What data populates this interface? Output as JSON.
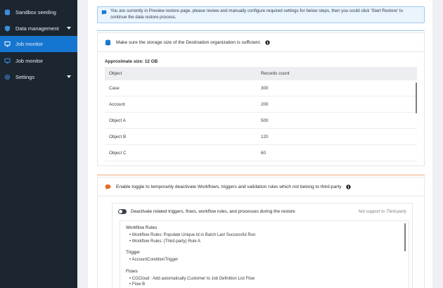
{
  "sidebar": {
    "items": [
      {
        "label": "Sandbox seeding",
        "icon": "database-icon"
      },
      {
        "label": "Data management",
        "icon": "shield-icon",
        "has_chevron": true
      },
      {
        "label": "Job monitor",
        "icon": "monitor-icon",
        "active": true
      },
      {
        "label": "Job monitor",
        "icon": "monitor-icon"
      },
      {
        "label": "Settings",
        "icon": "gear-icon",
        "has_chevron": true
      }
    ]
  },
  "info_banner": {
    "text": "You are currently in Preview restore page, please review and manually configure required settings for below steps, then you could click 'Start Restore' to continue the data restore process."
  },
  "storage_panel": {
    "title": "Make sure the storage size of the Destination organization is sufficient.",
    "size_label": "Approximate size: 12 GB",
    "columns": [
      "Object",
      "Records count"
    ],
    "rows": [
      {
        "object": "Case",
        "count": "300"
      },
      {
        "object": "Account",
        "count": "200"
      },
      {
        "object": "Object A",
        "count": "500"
      },
      {
        "object": "Object B",
        "count": "120"
      },
      {
        "object": "Object C",
        "count": "60"
      }
    ]
  },
  "toggle_panel": {
    "title": "Enable toggle to temporarily deactivate Workflows, triggers and validation rules which not belong to third-party",
    "toggle_label": "Deactivate related triggers, flows, workflow rules, and processes during the restore",
    "not_support_label": "Not support to Third-party",
    "groups": [
      {
        "title": "Workflow Rules",
        "items": [
          "Workflow Rules: Populate Unique Id in Batch Last Successful Run",
          "Workflow Rules: (Third-party) Rule A"
        ]
      },
      {
        "title": "Trigger",
        "items": [
          "AccountConditionTrigger"
        ]
      },
      {
        "title": "Flows",
        "items": [
          "CGCloud : Add automatically Customer to Job Definition List Flow",
          "Flow B"
        ]
      }
    ]
  },
  "colors": {
    "sidebar_bg": "#1b2630",
    "active_bg": "#1576d1",
    "info_bg": "#eaf4fd",
    "accent_blue": "#1576d1",
    "accent_orange": "#e8692c"
  }
}
